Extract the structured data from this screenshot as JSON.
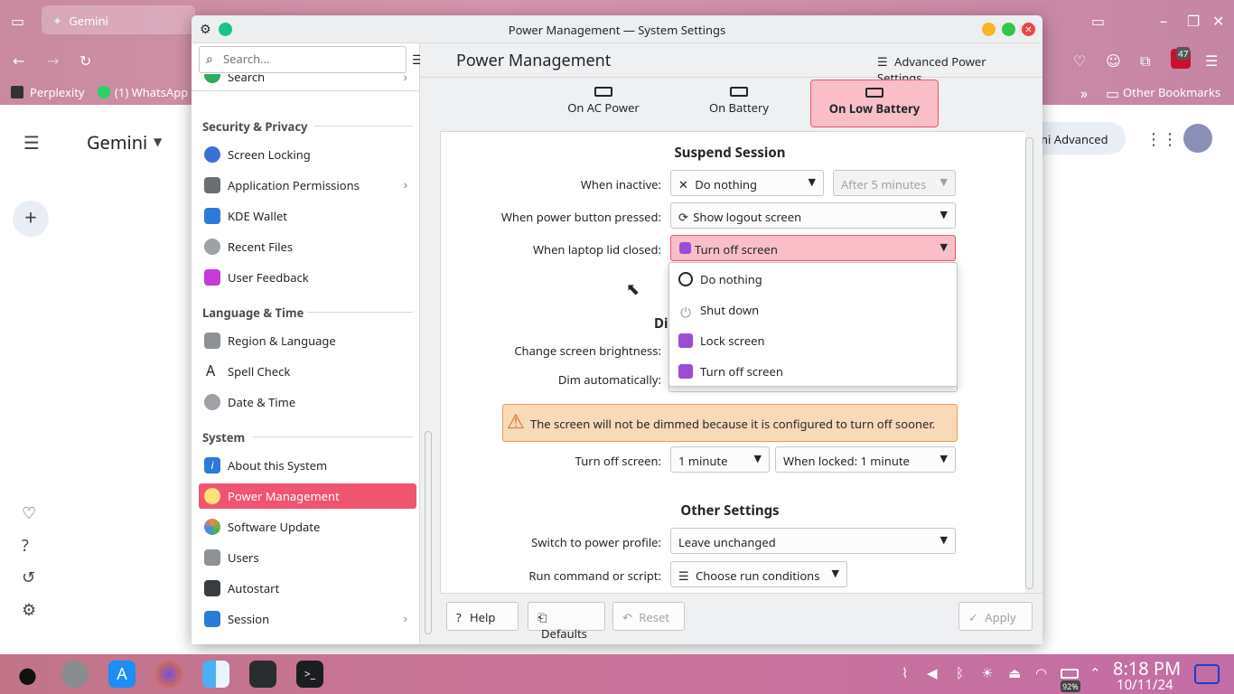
{
  "browser": {
    "tab_title": "Gemini",
    "bookmarks": [
      "Perplexity",
      "(1) WhatsApp",
      "Other Bookmarks"
    ],
    "badge_count": "47",
    "app_title": "Gemini",
    "advanced_btn": "ni Advanced"
  },
  "window": {
    "title": "Power Management — System Settings",
    "page_title": "Power Management",
    "advanced_settings": "Advanced Power Settings..."
  },
  "sidebar": {
    "search_placeholder": "Search...",
    "partial_item": "Search",
    "sections": [
      {
        "title": "Security & Privacy",
        "items": [
          "Screen Locking",
          "Application Permissions",
          "KDE Wallet",
          "Recent Files",
          "User Feedback"
        ]
      },
      {
        "title": "Language & Time",
        "items": [
          "Region & Language",
          "Spell Check",
          "Date & Time"
        ]
      },
      {
        "title": "System",
        "items": [
          "About this System",
          "Power Management",
          "Software Update",
          "Users",
          "Autostart",
          "Session"
        ]
      }
    ]
  },
  "power_tabs": [
    {
      "label": "On AC Power"
    },
    {
      "label": "On Battery"
    },
    {
      "label": "On Low Battery",
      "selected": true
    }
  ],
  "suspend": {
    "title": "Suspend Session",
    "when_inactive_label": "When inactive:",
    "when_inactive_value": "Do nothing",
    "after_value": "After 5 minutes",
    "power_button_label": "When power button pressed:",
    "power_button_value": "Show logout screen",
    "lid_label": "When laptop lid closed:",
    "lid_value": "Turn off screen"
  },
  "dropdown_options": [
    "Do nothing",
    "Shut down",
    "Lock screen",
    "Turn off screen"
  ],
  "display": {
    "title_partial": "Di",
    "brightness_label": "Change screen brightness:",
    "dim_label": "Dim automatically:",
    "warning": "The screen will not be dimmed because it is configured to turn off sooner.",
    "turn_off_label": "Turn off screen:",
    "turn_off_value": "1 minute",
    "when_locked_value": "When locked: 1 minute"
  },
  "other": {
    "title": "Other Settings",
    "profile_label": "Switch to power profile:",
    "profile_value": "Leave unchanged",
    "script_label": "Run command or script:",
    "script_value": "Choose run conditions"
  },
  "footer": {
    "help": "Help",
    "defaults": "Defaults",
    "reset": "Reset",
    "apply": "Apply"
  },
  "taskbar": {
    "time": "8:18 PM",
    "date": "10/11/24",
    "battery": "92%"
  },
  "colors": {
    "accent": "#f1546f",
    "accent_light": "#f9bec8"
  }
}
